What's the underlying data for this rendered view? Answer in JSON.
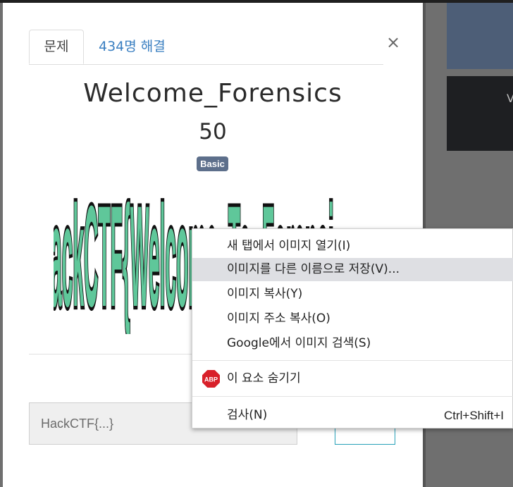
{
  "background": {
    "card_text": "V"
  },
  "modal": {
    "close_icon": "×",
    "tabs": [
      {
        "label": "문제",
        "active": true
      },
      {
        "label": "434명 해결",
        "active": false
      }
    ],
    "title": "Welcome_Forensics",
    "points": "50",
    "category_badge": "Basic",
    "image_text": "HackCTF{Welcome_To_Forensic}",
    "flag_input_placeholder": "HackCTF{...}"
  },
  "context_menu": {
    "items": [
      {
        "label": "새 탭에서 이미지 열기(I)"
      },
      {
        "label": "이미지를 다른 이름으로 저장(V)...",
        "highlighted": true
      },
      {
        "label": "이미지 복사(Y)"
      },
      {
        "label": "이미지 주소 복사(O)"
      },
      {
        "label": "Google에서 이미지 검색(S)"
      },
      {
        "label": "이 요소 숨기기",
        "icon": "adblock-plus-icon",
        "icon_text": "ABP"
      },
      {
        "label": "검사(N)",
        "shortcut": "Ctrl+Shift+I"
      }
    ]
  },
  "colors": {
    "accent_link": "#3a7fc1",
    "badge_bg": "#5d6f8b",
    "submit_border": "#27a0b8",
    "abp_red": "#d8202a",
    "captcha_fill": "#5fc79a"
  }
}
